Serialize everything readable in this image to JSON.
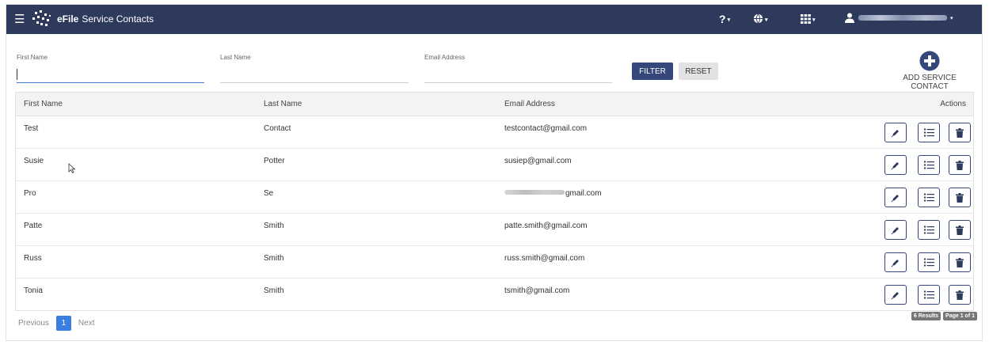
{
  "app": {
    "brand": "eFile",
    "title": "Service Contacts"
  },
  "topbar": {
    "menu_icon": "hamburger-menu-icon",
    "help_icon": "?",
    "caret": "▾"
  },
  "filters": {
    "first_name_label": "First Name",
    "last_name_label": "Last Name",
    "email_label": "Email Address",
    "first_name_value": "",
    "last_name_value": "",
    "email_value": "",
    "filter_label": "FILTER",
    "reset_label": "RESET"
  },
  "add_contact": {
    "label": "ADD SERVICE CONTACT"
  },
  "table": {
    "headers": {
      "first": "First Name",
      "last": "Last Name",
      "email": "Email Address",
      "actions": "Actions"
    },
    "rows": [
      {
        "first": "Test",
        "last": "Contact",
        "email": "testcontact@gmail.com"
      },
      {
        "first": "Susie",
        "last": "Potter",
        "email": "susiep@gmail.com"
      },
      {
        "first": "Pro",
        "last": "Se",
        "email": "gmail.com"
      },
      {
        "first": "Patte",
        "last": "Smith",
        "email": "patte.smith@gmail.com"
      },
      {
        "first": "Russ",
        "last": "Smith",
        "email": "russ.smith@gmail.com"
      },
      {
        "first": "Tonia",
        "last": "Smith",
        "email": "tsmith@gmail.com"
      }
    ]
  },
  "pagination": {
    "previous": "Previous",
    "current": "1",
    "next": "Next"
  },
  "status": {
    "results": "6 Results",
    "page": "Page 1 of 1"
  },
  "colors": {
    "navbar": "#2d3a5b",
    "primary": "#35477a",
    "page_active": "#3b7de0"
  }
}
